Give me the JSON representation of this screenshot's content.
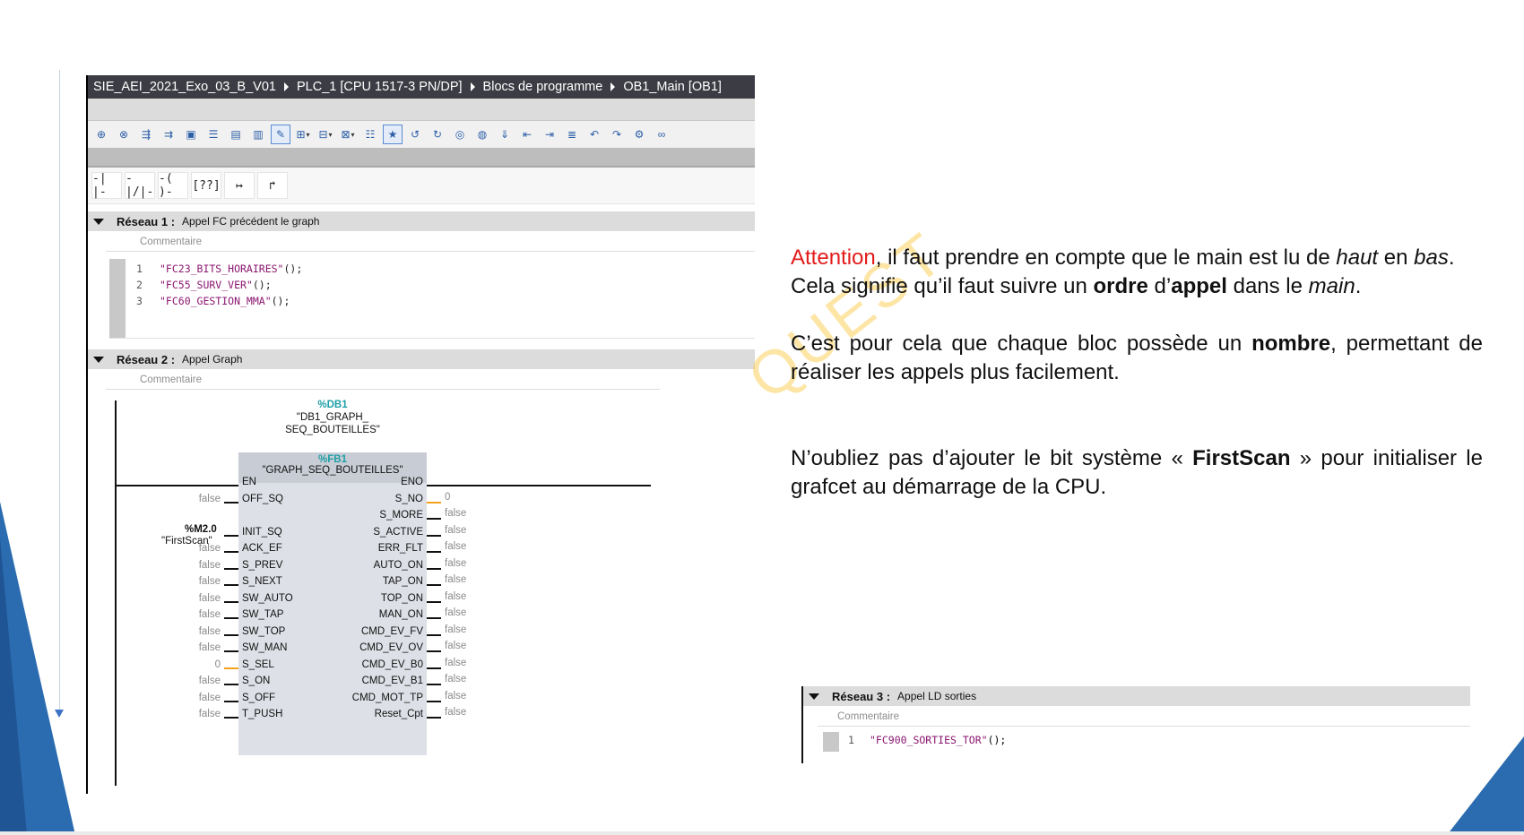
{
  "breadcrumb": [
    "SIE_AEI_2021_Exo_03_B_V01",
    "PLC_1 [CPU 1517-3 PN/DP]",
    "Blocs de programme",
    "OB1_Main [OB1]"
  ],
  "watermark_text": "QUEST",
  "ladder_tools": [
    "-| |-",
    "-|/|-",
    "-( )-",
    "[??]",
    "↦",
    "↱"
  ],
  "network1": {
    "title": "Réseau 1 :",
    "subtitle": "Appel FC précédent le graph",
    "comment": "Commentaire",
    "code": [
      {
        "n": "1",
        "text": "\"FC23_BITS_HORAIRES\"",
        "paren": "();"
      },
      {
        "n": "2",
        "text": "\"FC55_SURV_VER\"",
        "paren": "();"
      },
      {
        "n": "3",
        "text": "\"FC60_GESTION_MMA\"",
        "paren": "();"
      }
    ]
  },
  "network2": {
    "title": "Réseau 2 :",
    "subtitle": "Appel Graph",
    "comment": "Commentaire",
    "db_addr": "%DB1",
    "db_name_1": "\"DB1_GRAPH_",
    "db_name_2": "SEQ_BOUTEILLES\"",
    "fb_addr": "%FB1",
    "fb_name": "\"GRAPH_SEQ_BOUTEILLES\"",
    "m_addr": "%M2.0",
    "m_name": "\"FirstScan\"",
    "inputs": [
      {
        "pin": "EN",
        "val": ""
      },
      {
        "pin": "OFF_SQ",
        "val": "false"
      },
      {
        "pin": "INIT_SQ",
        "val": ""
      },
      {
        "pin": "ACK_EF",
        "val": "false"
      },
      {
        "pin": "S_PREV",
        "val": "false"
      },
      {
        "pin": "S_NEXT",
        "val": "false"
      },
      {
        "pin": "SW_AUTO",
        "val": "false"
      },
      {
        "pin": "SW_TAP",
        "val": "false"
      },
      {
        "pin": "SW_TOP",
        "val": "false"
      },
      {
        "pin": "SW_MAN",
        "val": "false"
      },
      {
        "pin": "S_SEL",
        "val": "0"
      },
      {
        "pin": "S_ON",
        "val": "false"
      },
      {
        "pin": "S_OFF",
        "val": "false"
      },
      {
        "pin": "T_PUSH",
        "val": "false"
      }
    ],
    "outputs": [
      {
        "pin": "ENO",
        "val": ""
      },
      {
        "pin": "S_NO",
        "val": "0"
      },
      {
        "pin": "S_MORE",
        "val": "false"
      },
      {
        "pin": "S_ACTIVE",
        "val": "false"
      },
      {
        "pin": "ERR_FLT",
        "val": "false"
      },
      {
        "pin": "AUTO_ON",
        "val": "false"
      },
      {
        "pin": "TAP_ON",
        "val": "false"
      },
      {
        "pin": "TOP_ON",
        "val": "false"
      },
      {
        "pin": "MAN_ON",
        "val": "false"
      },
      {
        "pin": "CMD_EV_FV",
        "val": "false"
      },
      {
        "pin": "CMD_EV_OV",
        "val": "false"
      },
      {
        "pin": "CMD_EV_B0",
        "val": "false"
      },
      {
        "pin": "CMD_EV_B1",
        "val": "false"
      },
      {
        "pin": "CMD_MOT_TP",
        "val": "false"
      },
      {
        "pin": "Reset_Cpt",
        "val": "false"
      }
    ]
  },
  "network3": {
    "title": "Réseau 3 :",
    "subtitle": "Appel LD sorties",
    "comment": "Commentaire",
    "code": {
      "n": "1",
      "text": "\"FC900_SORTIES_TOR\"",
      "paren": "();"
    }
  },
  "explanation": {
    "p1_attention": "Attention",
    "p1_a": ", il faut prendre en compte que le main est lu de ",
    "p1_haut": "haut",
    "p1_b": " en ",
    "p1_bas": "bas",
    "p1_c": ".",
    "p2_a": "Cela signifie qu’il faut suivre un ",
    "p2_ordre": "ordre",
    "p2_b": " d’",
    "p2_appel": "appel",
    "p2_c": " dans le ",
    "p2_main": "main",
    "p2_d": ".",
    "p3_a": "C’est pour cela que chaque bloc possède un ",
    "p3_nombre": "nombre",
    "p3_b": ", permettant de réaliser les appels plus facilement.",
    "p4_a": "N’oubliez pas d’ajouter le bit système « ",
    "p4_firstscan": "FirstScan",
    "p4_b": " » pour initialiser le grafcet au démarrage de la CPU."
  },
  "colors": {
    "accent_blue": "#2b6cb0",
    "attention_red": "#e31b1b",
    "teal": "#1e9fa6"
  }
}
